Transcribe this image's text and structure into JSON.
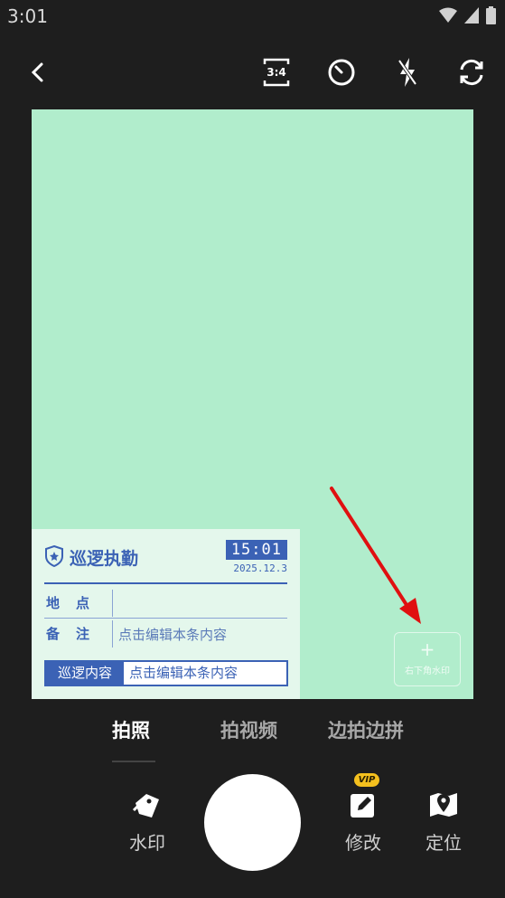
{
  "status_bar": {
    "time": "3:01"
  },
  "toolbar": {
    "back_icon": "chevron-left-icon",
    "ratio_label": "3:4",
    "timer_icon": "timer-icon",
    "flash_icon": "flash-off-icon",
    "switch_icon": "camera-switch-icon"
  },
  "preview": {
    "background": "#b1edcc"
  },
  "watermark": {
    "title": "巡逻执勤",
    "time": "15:01",
    "date": "2025.12.3",
    "rows": [
      {
        "label": "地点",
        "value": ""
      },
      {
        "label": "备注",
        "value": "点击编辑本条内容"
      }
    ],
    "box_label": "巡逻内容",
    "box_value": "点击编辑本条内容",
    "accent": "#3b62b5"
  },
  "add_watermark": {
    "plus": "+",
    "label": "右下角水印"
  },
  "modes": [
    {
      "label": "拍照",
      "active": true
    },
    {
      "label": "拍视频",
      "active": false
    },
    {
      "label": "边拍边拼",
      "active": false
    }
  ],
  "tools": {
    "watermark": {
      "label": "水印",
      "icon": "tag-icon"
    },
    "edit": {
      "label": "修改",
      "icon": "edit-icon",
      "badge": "VIP"
    },
    "location": {
      "label": "定位",
      "icon": "map-pin-icon"
    }
  }
}
